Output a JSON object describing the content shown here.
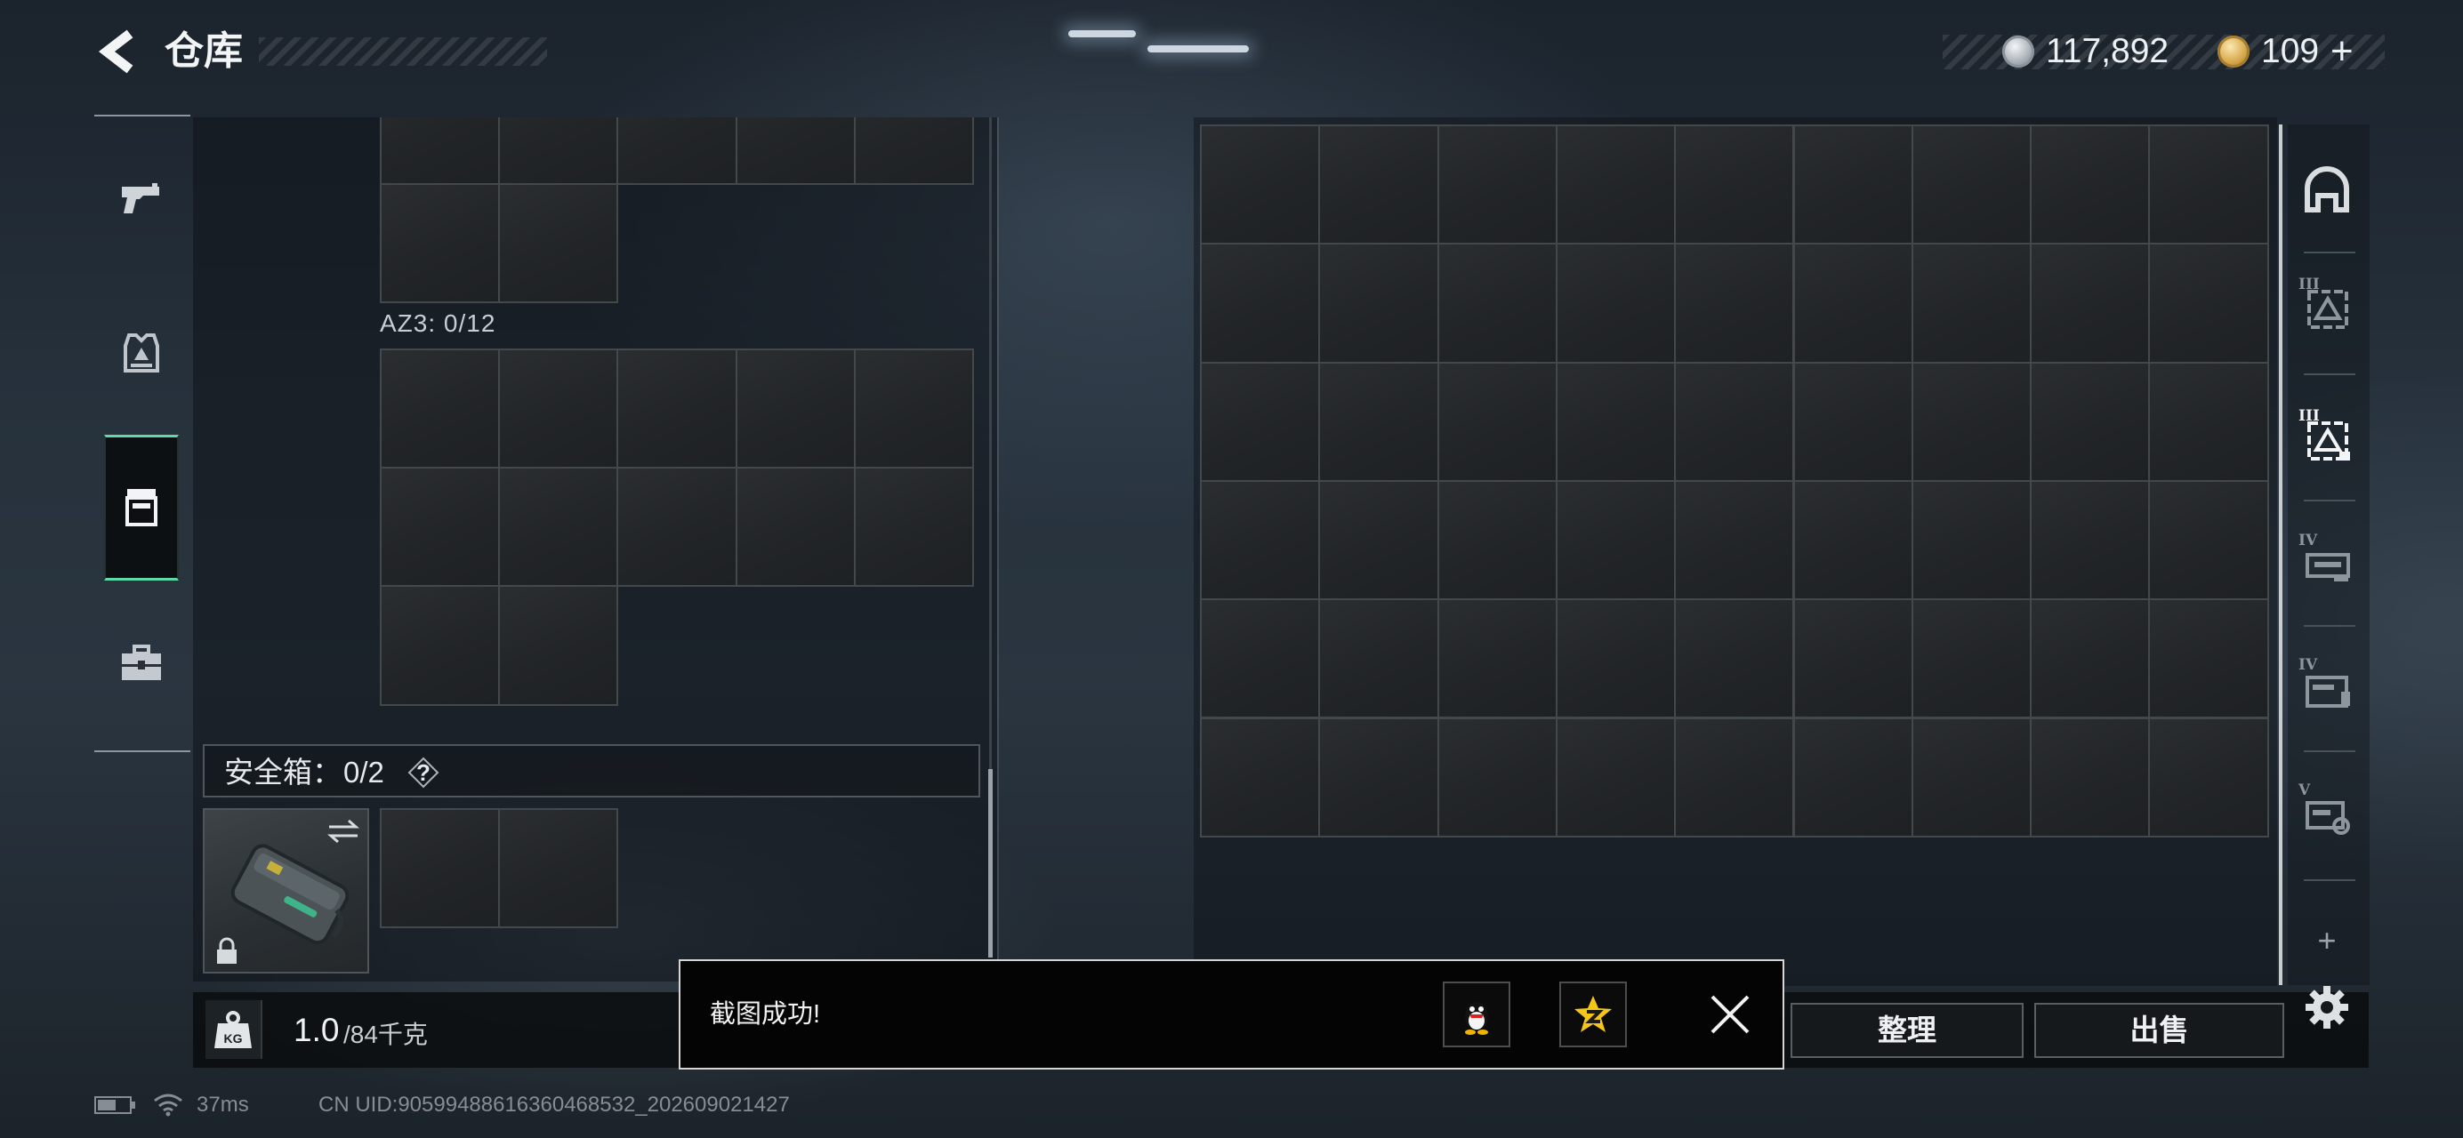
{
  "header": {
    "title": "仓库",
    "currency_primary": "117,892",
    "currency_secondary": "109",
    "add_label": "+"
  },
  "left_nav": {
    "items": [
      {
        "icon": "pistol-icon",
        "selected": false
      },
      {
        "icon": "armor-icon",
        "selected": false
      },
      {
        "icon": "chest-rig-icon",
        "selected": true
      },
      {
        "icon": "toolbox-icon",
        "selected": false
      }
    ]
  },
  "containers": {
    "az3_label": "AZ3: 0/12",
    "safe_box": {
      "label": "安全箱：",
      "count": "0/2",
      "help": "?"
    }
  },
  "weight": {
    "icon_text": "KG",
    "current": "1.0",
    "max": "/84千克"
  },
  "actions": {
    "sort_label": "整理",
    "sell_label": "出售"
  },
  "right_rail": {
    "tiers": [
      "III",
      "III",
      "IV",
      "IV",
      "V"
    ],
    "selected_index": 1,
    "add_label": "+"
  },
  "toast": {
    "message": "截图成功!",
    "share_icons": [
      "qq-icon",
      "qzone-icon"
    ]
  },
  "status": {
    "ping": "37ms",
    "uid": "CN UID:90599488616360468532_202609021427"
  },
  "colors": {
    "accent_green": "#5fd9a8",
    "panel_bg": "#0e1217",
    "cell_border": "#43484d",
    "toast_bg": "#040404",
    "coin_silver": "#c7ccd2",
    "coin_gold": "#d7a84a"
  }
}
